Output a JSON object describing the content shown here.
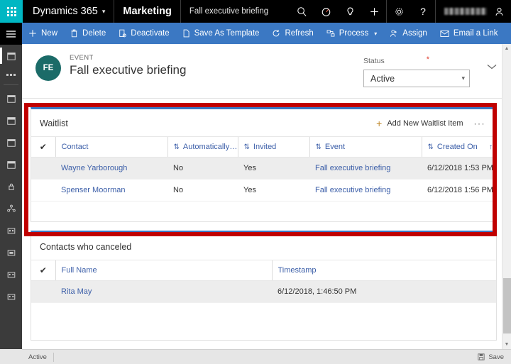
{
  "topnav": {
    "waffle_label": "app-launcher",
    "brand": "Dynamics 365",
    "app": "Marketing",
    "record": "Fall executive briefing",
    "icons": [
      "search-icon",
      "timer-icon",
      "lightbulb-icon",
      "plus-icon",
      "gear-icon",
      "help-icon"
    ],
    "user_name": ""
  },
  "commandbar": {
    "items": [
      {
        "label": "New",
        "icon": "plus-icon"
      },
      {
        "label": "Delete",
        "icon": "trash-icon"
      },
      {
        "label": "Deactivate",
        "icon": "deactivate-icon"
      },
      {
        "label": "Save As Template",
        "icon": "template-icon"
      },
      {
        "label": "Refresh",
        "icon": "refresh-icon"
      },
      {
        "label": "Process",
        "icon": "process-icon",
        "chevron": "⌄"
      },
      {
        "label": "Assign",
        "icon": "assign-user-icon"
      },
      {
        "label": "Email a Link",
        "icon": "email-link-icon"
      }
    ],
    "overflow": "···"
  },
  "record": {
    "avatar_initials": "FE",
    "kicker": "EVENT",
    "title": "Fall executive briefing",
    "status_label": "Status",
    "required_marker": "*",
    "status_value": "Active",
    "status_chevron": "⌄",
    "collapse_chevron": "⌄"
  },
  "waitlist": {
    "title": "Waitlist",
    "add_label": "Add New Waitlist Item",
    "add_plus": "+",
    "overflow": "···",
    "columns": [
      {
        "label": "Contact",
        "sort": "⇅"
      },
      {
        "label": "Automatically ...",
        "sort": "⇅"
      },
      {
        "label": "Invited",
        "sort": "⇅"
      },
      {
        "label": "Event",
        "sort": "⇅"
      },
      {
        "label": "Created On",
        "sort": "↑"
      }
    ],
    "select_all": "✔",
    "rows": [
      {
        "contact": "Wayne Yarborough",
        "automatically": "No",
        "invited": "Yes",
        "event": "Fall executive briefing",
        "created_on": "6/12/2018 1:53 PM"
      },
      {
        "contact": "Spenser Moorman",
        "automatically": "No",
        "invited": "Yes",
        "event": "Fall executive briefing",
        "created_on": "6/12/2018 1:56 PM"
      }
    ]
  },
  "canceled": {
    "title": "Contacts who canceled",
    "select_all": "✔",
    "columns": [
      {
        "label": "Full Name"
      },
      {
        "label": "Timestamp"
      }
    ],
    "rows": [
      {
        "full_name": "Rita May",
        "timestamp": "6/12/2018, 1:46:50 PM"
      }
    ]
  },
  "statusbar": {
    "left": "Active",
    "save_label": "Save",
    "save_icon": "save-icon"
  },
  "colors": {
    "accent_blue": "#3b78c3",
    "brand_teal": "#00b7c3",
    "avatar_teal": "#1b6b68",
    "link_blue": "#3b5ea8",
    "callout_red": "#c00000",
    "rail_gray": "#3b3b3b"
  }
}
